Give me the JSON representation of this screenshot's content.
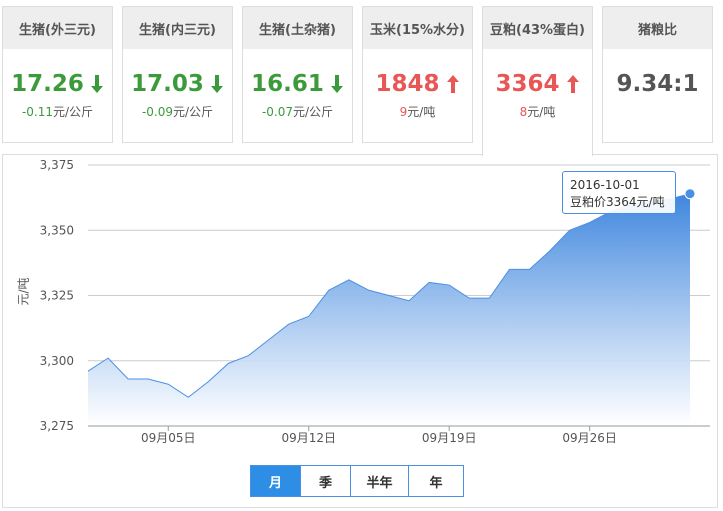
{
  "cards": [
    {
      "title": "生猪(外三元)",
      "price": "17.26",
      "trend": "down",
      "change_value": "-0.11",
      "change_unit": "元/公斤"
    },
    {
      "title": "生猪(内三元)",
      "price": "17.03",
      "trend": "down",
      "change_value": "-0.09",
      "change_unit": "元/公斤"
    },
    {
      "title": "生猪(土杂猪)",
      "price": "16.61",
      "trend": "down",
      "change_value": "-0.07",
      "change_unit": "元/公斤"
    },
    {
      "title": "玉米(15%水分)",
      "price": "1848",
      "trend": "up",
      "change_value": "9",
      "change_unit": "元/吨"
    },
    {
      "title": "豆粕(43%蛋白)",
      "price": "3364",
      "trend": "up",
      "change_value": "8",
      "change_unit": "元/吨"
    },
    {
      "title": "猪粮比",
      "price": "9.34:1",
      "trend": "none",
      "change_value": "",
      "change_unit": ""
    }
  ],
  "colors": {
    "down": "#3b9b3b",
    "up": "#e85656",
    "series": "#4a90e2"
  },
  "tooltip": {
    "date": "2016-10-01",
    "label": "豆粕价3364元/吨"
  },
  "range_buttons": [
    {
      "label": "月",
      "active": true
    },
    {
      "label": "季",
      "active": false
    },
    {
      "label": "半年",
      "active": false
    },
    {
      "label": "年",
      "active": false
    }
  ],
  "chart_data": {
    "type": "area",
    "ylabel": "元/吨",
    "ylim": [
      3275,
      3375
    ],
    "yticks": [
      3275,
      3300,
      3325,
      3350,
      3375
    ],
    "ytick_labels": [
      "3,275",
      "3,300",
      "3,325",
      "3,350",
      "3,375"
    ],
    "xticks": [
      {
        "x": "09-05",
        "label": "09月05日"
      },
      {
        "x": "09-12",
        "label": "09月12日"
      },
      {
        "x": "09-19",
        "label": "09月19日"
      },
      {
        "x": "09-26",
        "label": "09月26日"
      }
    ],
    "grid": true,
    "series": [
      {
        "values": [
          {
            "x": "09-01",
            "y": 3296
          },
          {
            "x": "09-02",
            "y": 3301
          },
          {
            "x": "09-03",
            "y": 3293
          },
          {
            "x": "09-04",
            "y": 3293
          },
          {
            "x": "09-05",
            "y": 3291
          },
          {
            "x": "09-06",
            "y": 3286
          },
          {
            "x": "09-07",
            "y": 3292
          },
          {
            "x": "09-08",
            "y": 3299
          },
          {
            "x": "09-09",
            "y": 3302
          },
          {
            "x": "09-10",
            "y": 3308
          },
          {
            "x": "09-11",
            "y": 3314
          },
          {
            "x": "09-12",
            "y": 3317
          },
          {
            "x": "09-13",
            "y": 3327
          },
          {
            "x": "09-14",
            "y": 3331
          },
          {
            "x": "09-15",
            "y": 3327
          },
          {
            "x": "09-16",
            "y": 3325
          },
          {
            "x": "09-17",
            "y": 3323
          },
          {
            "x": "09-18",
            "y": 3330
          },
          {
            "x": "09-19",
            "y": 3329
          },
          {
            "x": "09-20",
            "y": 3324
          },
          {
            "x": "09-21",
            "y": 3324
          },
          {
            "x": "09-22",
            "y": 3335
          },
          {
            "x": "09-23",
            "y": 3335
          },
          {
            "x": "09-24",
            "y": 3342
          },
          {
            "x": "09-25",
            "y": 3350
          },
          {
            "x": "09-26",
            "y": 3353
          },
          {
            "x": "09-27",
            "y": 3357
          },
          {
            "x": "09-28",
            "y": 3360
          },
          {
            "x": "09-29",
            "y": 3361
          },
          {
            "x": "09-30",
            "y": 3362
          },
          {
            "x": "10-01",
            "y": 3364
          }
        ]
      }
    ]
  }
}
